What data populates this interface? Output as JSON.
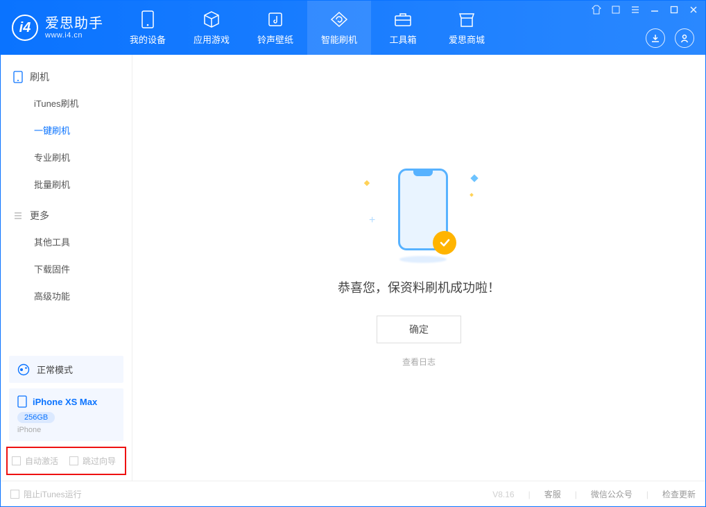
{
  "app": {
    "name": "爱思助手",
    "site": "www.i4.cn"
  },
  "tabs": [
    {
      "label": "我的设备",
      "icon": "device-icon"
    },
    {
      "label": "应用游戏",
      "icon": "cube-icon"
    },
    {
      "label": "铃声壁纸",
      "icon": "music-icon"
    },
    {
      "label": "智能刷机",
      "icon": "refresh-icon",
      "active": true
    },
    {
      "label": "工具箱",
      "icon": "toolbox-icon"
    },
    {
      "label": "爱思商城",
      "icon": "shop-icon"
    }
  ],
  "sidebar": {
    "group1_title": "刷机",
    "group1_items": [
      "iTunes刷机",
      "一键刷机",
      "专业刷机",
      "批量刷机"
    ],
    "group1_active_index": 1,
    "group2_title": "更多",
    "group2_items": [
      "其他工具",
      "下载固件",
      "高级功能"
    ]
  },
  "mode": {
    "label": "正常模式"
  },
  "device": {
    "name": "iPhone XS Max",
    "capacity": "256GB",
    "type": "iPhone"
  },
  "options": {
    "auto_activate": "自动激活",
    "skip_guide": "跳过向导"
  },
  "main": {
    "success_text": "恭喜您，保资料刷机成功啦！",
    "ok_label": "确定",
    "log_link": "查看日志"
  },
  "footer": {
    "block_itunes": "阻止iTunes运行",
    "version": "V8.16",
    "links": [
      "客服",
      "微信公众号",
      "检查更新"
    ]
  }
}
